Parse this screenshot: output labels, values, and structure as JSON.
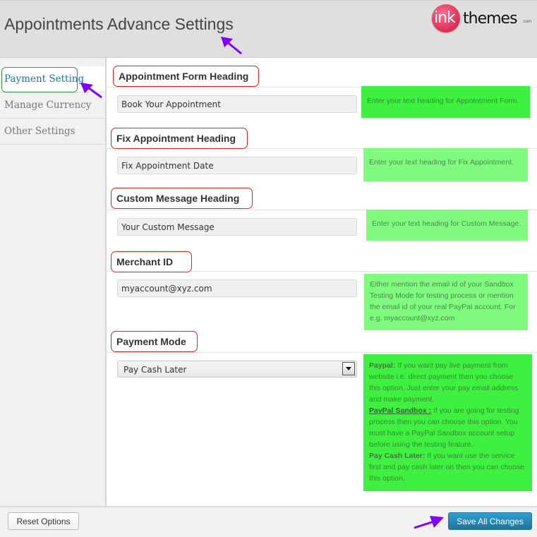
{
  "header": {
    "title": "Appointments Advance Settings",
    "logo": {
      "ink": "ink",
      "themes": "themes",
      "com": ".com"
    }
  },
  "sidebar": {
    "items": [
      {
        "label": "Payment Setting",
        "active": true
      },
      {
        "label": "Manage Currency",
        "active": false
      },
      {
        "label": "Other Settings",
        "active": false
      }
    ]
  },
  "sections": [
    {
      "label": "Appointment Form Heading",
      "value": "Book Your Appointment",
      "help": "Enter your text heading for Appointment Form."
    },
    {
      "label": "Fix Appointment Heading",
      "value": "Fix Appointment Date",
      "help": "Enter your text heading for Fix Appointment."
    },
    {
      "label": "Custom Message Heading",
      "value": "Your Custom Message",
      "help": "Enter your text heading for Custom Message."
    },
    {
      "label": "Merchant ID",
      "value": "myaccount@xyz.com",
      "help": "Either mention the email id of your Sandbox Testing Mode for testing process or mention the email id of your real PayPal account. For e.g. myaccount@xyz.com"
    },
    {
      "label": "Payment Mode",
      "selected": "Pay Cash Later",
      "help": {
        "paypal_title": "Paypal:",
        "paypal_text": " If you want pay live payment from website i.e. direct payment then you choose this option. Just enter your pay email address and make payment.",
        "sandbox_title": "PayPal Sandbox :",
        "sandbox_text": " If you are going for testing process then you can choose this option. You must have a PayPal Sandbox account setup before using the testing feature.",
        "cash_title": "Pay Cash Later:",
        "cash_text": " If you want use the service first and pay cash later on then you can choose this option."
      }
    }
  ],
  "footer": {
    "reset_label": "Reset Options",
    "save_label": "Save All Changes"
  },
  "colors": {
    "accent": "#21759b",
    "annotation_red": "#dd2222",
    "annotation_green": "#2e9a3c",
    "arrow_purple": "#8000ff",
    "help_bright": "#40f040",
    "help_light": "#80fb80"
  }
}
